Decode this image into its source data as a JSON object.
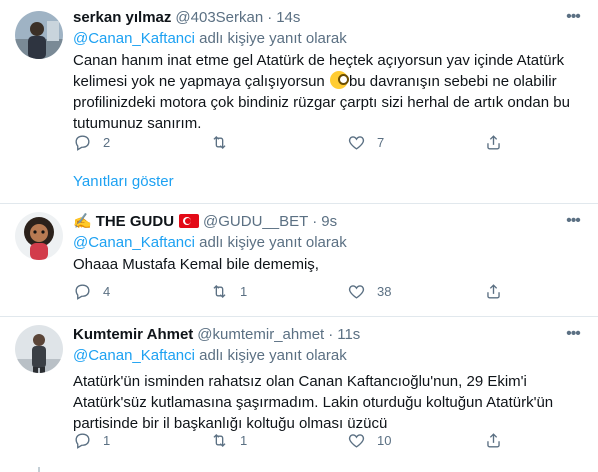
{
  "tweets": [
    {
      "name": "serkan yılmaz",
      "handle": "@403Serkan",
      "time": "14s",
      "reply_prefix": "",
      "mention": "@Canan_Kaftanci",
      "reply_suffix": " adlı kişiye yanıt olarak",
      "text_part1": "Canan hanım inat etme gel Atatürk de heçtek açıyorsun yav içinde Atatürk kelimesi yok ne yapmaya çalışıyorsun ",
      "text_part2": "bu davranışın sebebi ne olabilir profilinizdeki motora çok bindiniz rüzgar çarptı sizi herhal de artık ondan bu tutumunuz sanırım.",
      "reply_count": "2",
      "retweet_count": "",
      "like_count": "7",
      "show_replies": "Yanıtları göster"
    },
    {
      "name": "THE GUDU",
      "handle": "@GUDU__BET",
      "time": "9s",
      "mention": "@Canan_Kaftanci",
      "reply_suffix": " adlı kişiye yanıt olarak",
      "text": "Ohaaa Mustafa Kemal bile dememiş,",
      "reply_count": "4",
      "retweet_count": "1",
      "like_count": "38"
    },
    {
      "name": "Kumtemir Ahmet",
      "handle": "@kumtemir_ahmet",
      "time": "11s",
      "mention": "@Canan_Kaftanci",
      "reply_suffix": " adlı kişiye yanıt olarak",
      "text": "Atatürk'ün isminden rahatsız olan Canan Kaftancıoğlu'nun, 29 Ekim'i Atatürk'süz kutlamasına şaşırmadım. Lakin oturduğu koltuğun Atatürk'ün partisinde bir il başkanlığı koltuğu olması üzücü",
      "reply_count": "1",
      "retweet_count": "1",
      "like_count": "10"
    }
  ],
  "more_glyph": "•••",
  "dot": "·",
  "colors": {
    "link": "#1da1f2",
    "muted": "#5b7083",
    "text": "#0f1419",
    "border": "#e1e8ed"
  }
}
